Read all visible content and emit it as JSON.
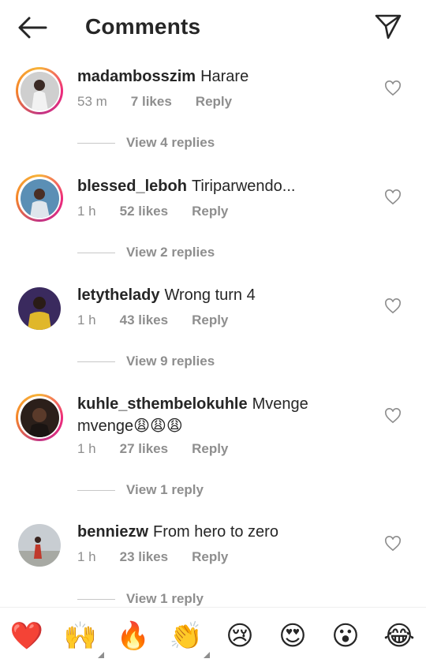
{
  "header": {
    "title": "Comments"
  },
  "comments": [
    {
      "username": "madambosszim",
      "text": "Harare",
      "time": "53 m",
      "likes": "7 likes",
      "reply": "Reply",
      "view_replies": "View 4 replies"
    },
    {
      "username": "blessed_leboh",
      "text": "Tiriparwendo...",
      "time": "1 h",
      "likes": "52 likes",
      "reply": "Reply",
      "view_replies": "View 2 replies"
    },
    {
      "username": "letythelady",
      "text": "Wrong turn 4",
      "time": "1 h",
      "likes": "43 likes",
      "reply": "Reply",
      "view_replies": "View 9 replies"
    },
    {
      "username": "kuhle_sthembelokuhle",
      "text": "Mvenge mvenge😩😩😩",
      "time": "1 h",
      "likes": "27 likes",
      "reply": "Reply",
      "view_replies": "View 1 reply"
    },
    {
      "username": "benniezw",
      "text": "From hero to zero",
      "time": "1 h",
      "likes": "23 likes",
      "reply": "Reply",
      "view_replies": "View 1 reply"
    }
  ],
  "emoji_bar": [
    "❤️",
    "🙌",
    "🔥",
    "👏",
    "😢",
    "😍",
    "😮",
    "😂"
  ],
  "colors": {
    "text": "#262626",
    "secondary": "#8e8e8e",
    "heart": "#ed4956"
  }
}
